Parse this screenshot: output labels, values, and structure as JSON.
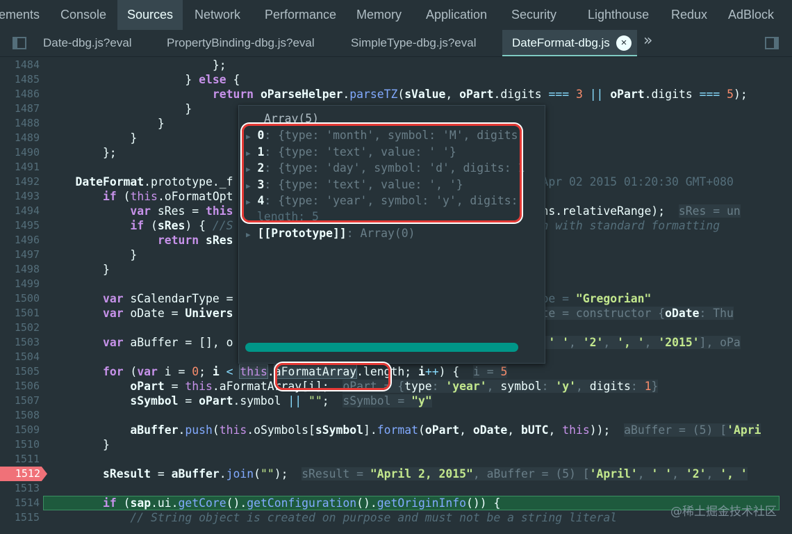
{
  "top_tabs": [
    "ements",
    "Console",
    "Sources",
    "Network",
    "Performance",
    "Memory",
    "Application",
    "Security",
    "Lighthouse",
    "Redux",
    "AdBlock"
  ],
  "active_top_tab": "Sources",
  "file_tabs": [
    "Date-dbg.js?eval",
    "PropertyBinding-dbg.js?eval",
    "SimpleType-dbg.js?eval",
    "DateFormat-dbg.js"
  ],
  "active_file_tab": "DateFormat-dbg.js",
  "close_label": "×",
  "more_tabs_label": "»",
  "line_numbers": [
    "1484",
    "1485",
    "1486",
    "1487",
    "1488",
    "1489",
    "1490",
    "1491",
    "1492",
    "1493",
    "1494",
    "1495",
    "1496",
    "1497",
    "1498",
    "1499",
    "1500",
    "1501",
    "1502",
    "1503",
    "1504",
    "1505",
    "1506",
    "1507",
    "1508",
    "1509",
    "1510",
    "1511",
    "1512",
    "1513",
    "1514",
    "1515"
  ],
  "breakpoint_line": "1512",
  "execution_line": "1514",
  "popover": {
    "title": "Array(5)",
    "rows": [
      {
        "idx": "0",
        "text": "{type: 'month', symbol: 'M', digits:"
      },
      {
        "idx": "1",
        "text": "{type: 'text', value: ' '}"
      },
      {
        "idx": "2",
        "text": "{type: 'day', symbol: 'd', digits: 1"
      },
      {
        "idx": "3",
        "text": "{type: 'text', value: ', '}"
      },
      {
        "idx": "4",
        "text": "{type: 'year', symbol: 'y', digits:"
      }
    ],
    "length_label": "length: 5",
    "prototype_label": "[[Prototype]]",
    "prototype_value": "Array(0)"
  },
  "hover_token": "aFormatArray",
  "watermark": "@稀土掘金技术社区",
  "colors": {
    "background": "#263238",
    "accent": "#80cbc4",
    "breakpoint": "#f07178",
    "highlight_box": "#e53935",
    "scrollbar": "#009688"
  }
}
